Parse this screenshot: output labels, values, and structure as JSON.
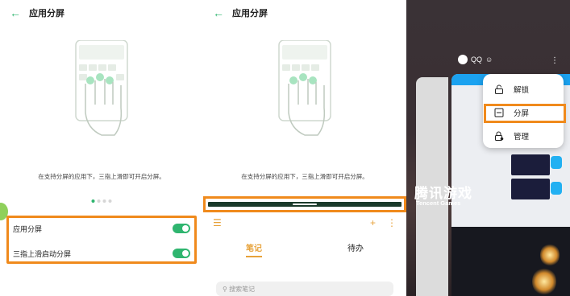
{
  "panel1": {
    "header_title": "应用分屏",
    "description": "在支持分屏的应用下，三指上滑即可开启分屏。",
    "settings": [
      {
        "label": "应用分屏",
        "enabled": true
      },
      {
        "label": "三指上滑启动分屏",
        "enabled": true
      }
    ],
    "page_indicator": {
      "total": 4,
      "active": 1
    }
  },
  "panel2": {
    "header_title": "应用分屏",
    "description": "在支持分屏的应用下，三指上滑即可开启分屏。",
    "notes_tabs": [
      "笔记",
      "待办"
    ],
    "search_placeholder": "搜索笔记"
  },
  "panel3": {
    "app_name": "QQ",
    "menu_items": [
      "解锁",
      "分屏",
      "管理"
    ],
    "game_title": "腾讯游戏",
    "game_subtitle": "Tencent Games"
  },
  "colors": {
    "accent_green": "#2fb56f",
    "highlight_orange": "#f08a1c",
    "notes_yellow": "#e7a23a",
    "qq_blue": "#1ba2f0"
  }
}
